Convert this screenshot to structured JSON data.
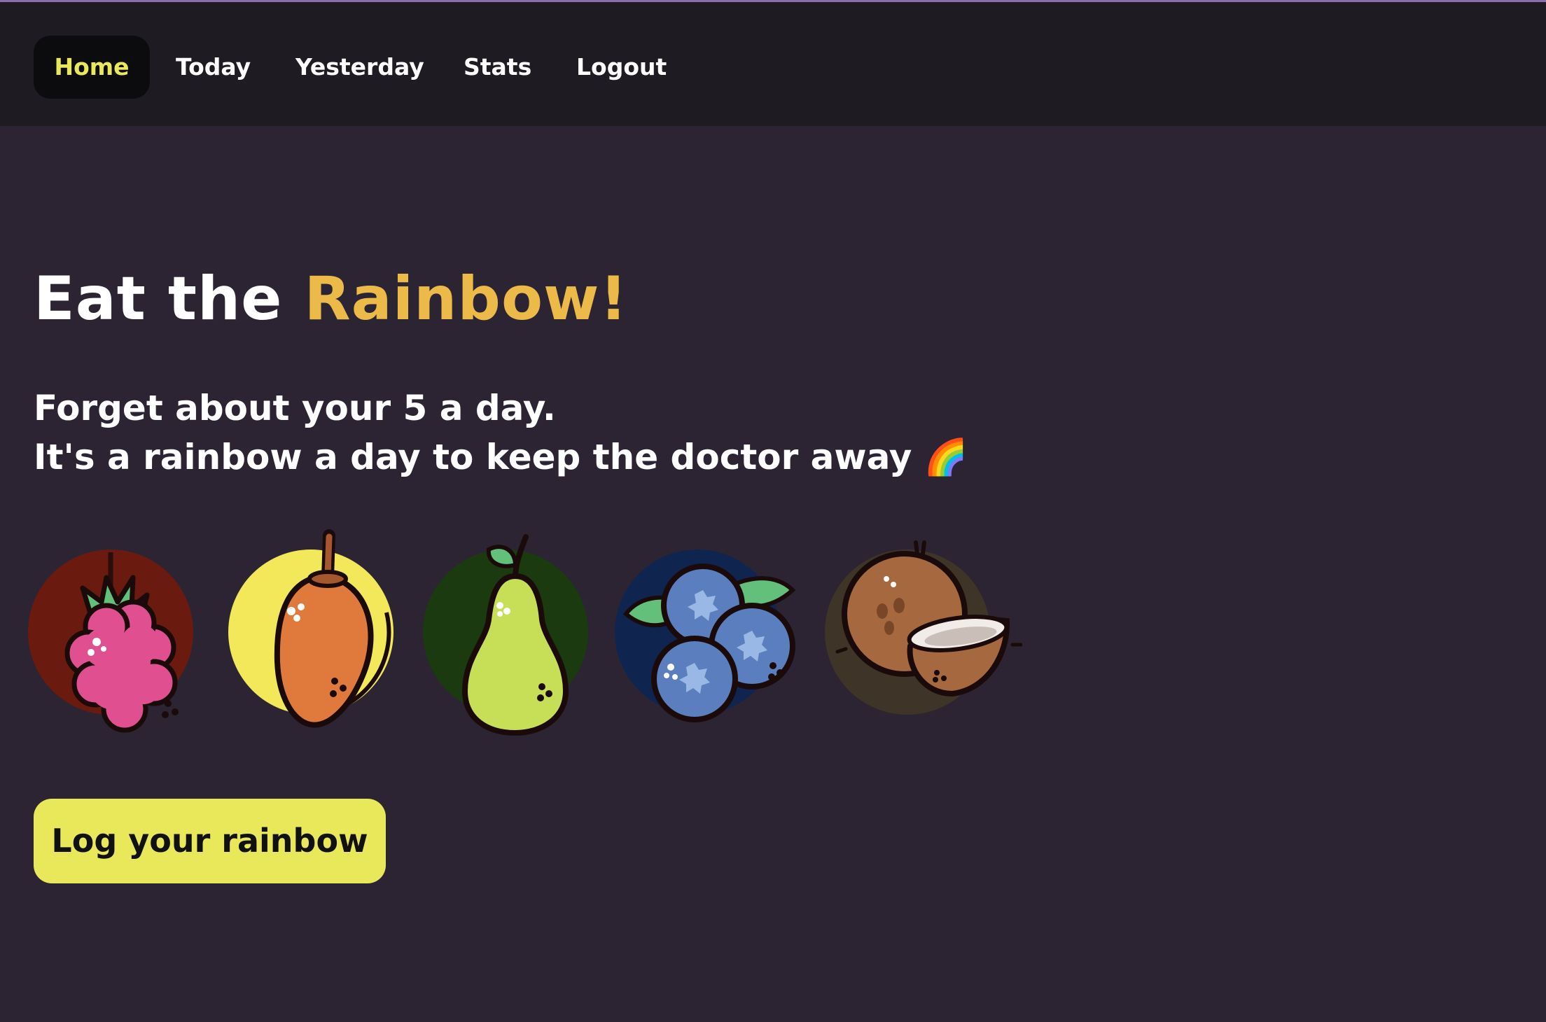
{
  "nav": {
    "items": [
      {
        "label": "Home",
        "active": true
      },
      {
        "label": "Today"
      },
      {
        "label": "Yesterday"
      },
      {
        "label": "Stats"
      },
      {
        "label": "Logout"
      }
    ]
  },
  "hero": {
    "title_prefix": "Eat the ",
    "title_accent": "Rainbow!",
    "line1": "Forget about your 5 a day.",
    "line2": "It's a rainbow a day to keep the doctor away 🌈"
  },
  "fruits": [
    {
      "name": "raspberry-icon",
      "bg": "#6b1a0f"
    },
    {
      "name": "mango-icon",
      "bg": "#f2e85a"
    },
    {
      "name": "pear-icon",
      "bg": "#1b3a10"
    },
    {
      "name": "blueberries-icon",
      "bg": "#0f2550"
    },
    {
      "name": "coconut-icon",
      "bg": "#3e3427"
    }
  ],
  "cta": {
    "label": "Log your rainbow"
  },
  "colors": {
    "background": "#2c2433",
    "navbar": "#1e1b22",
    "accent_yellow": "#e9e85a",
    "accent_gold": "#ecba48"
  }
}
